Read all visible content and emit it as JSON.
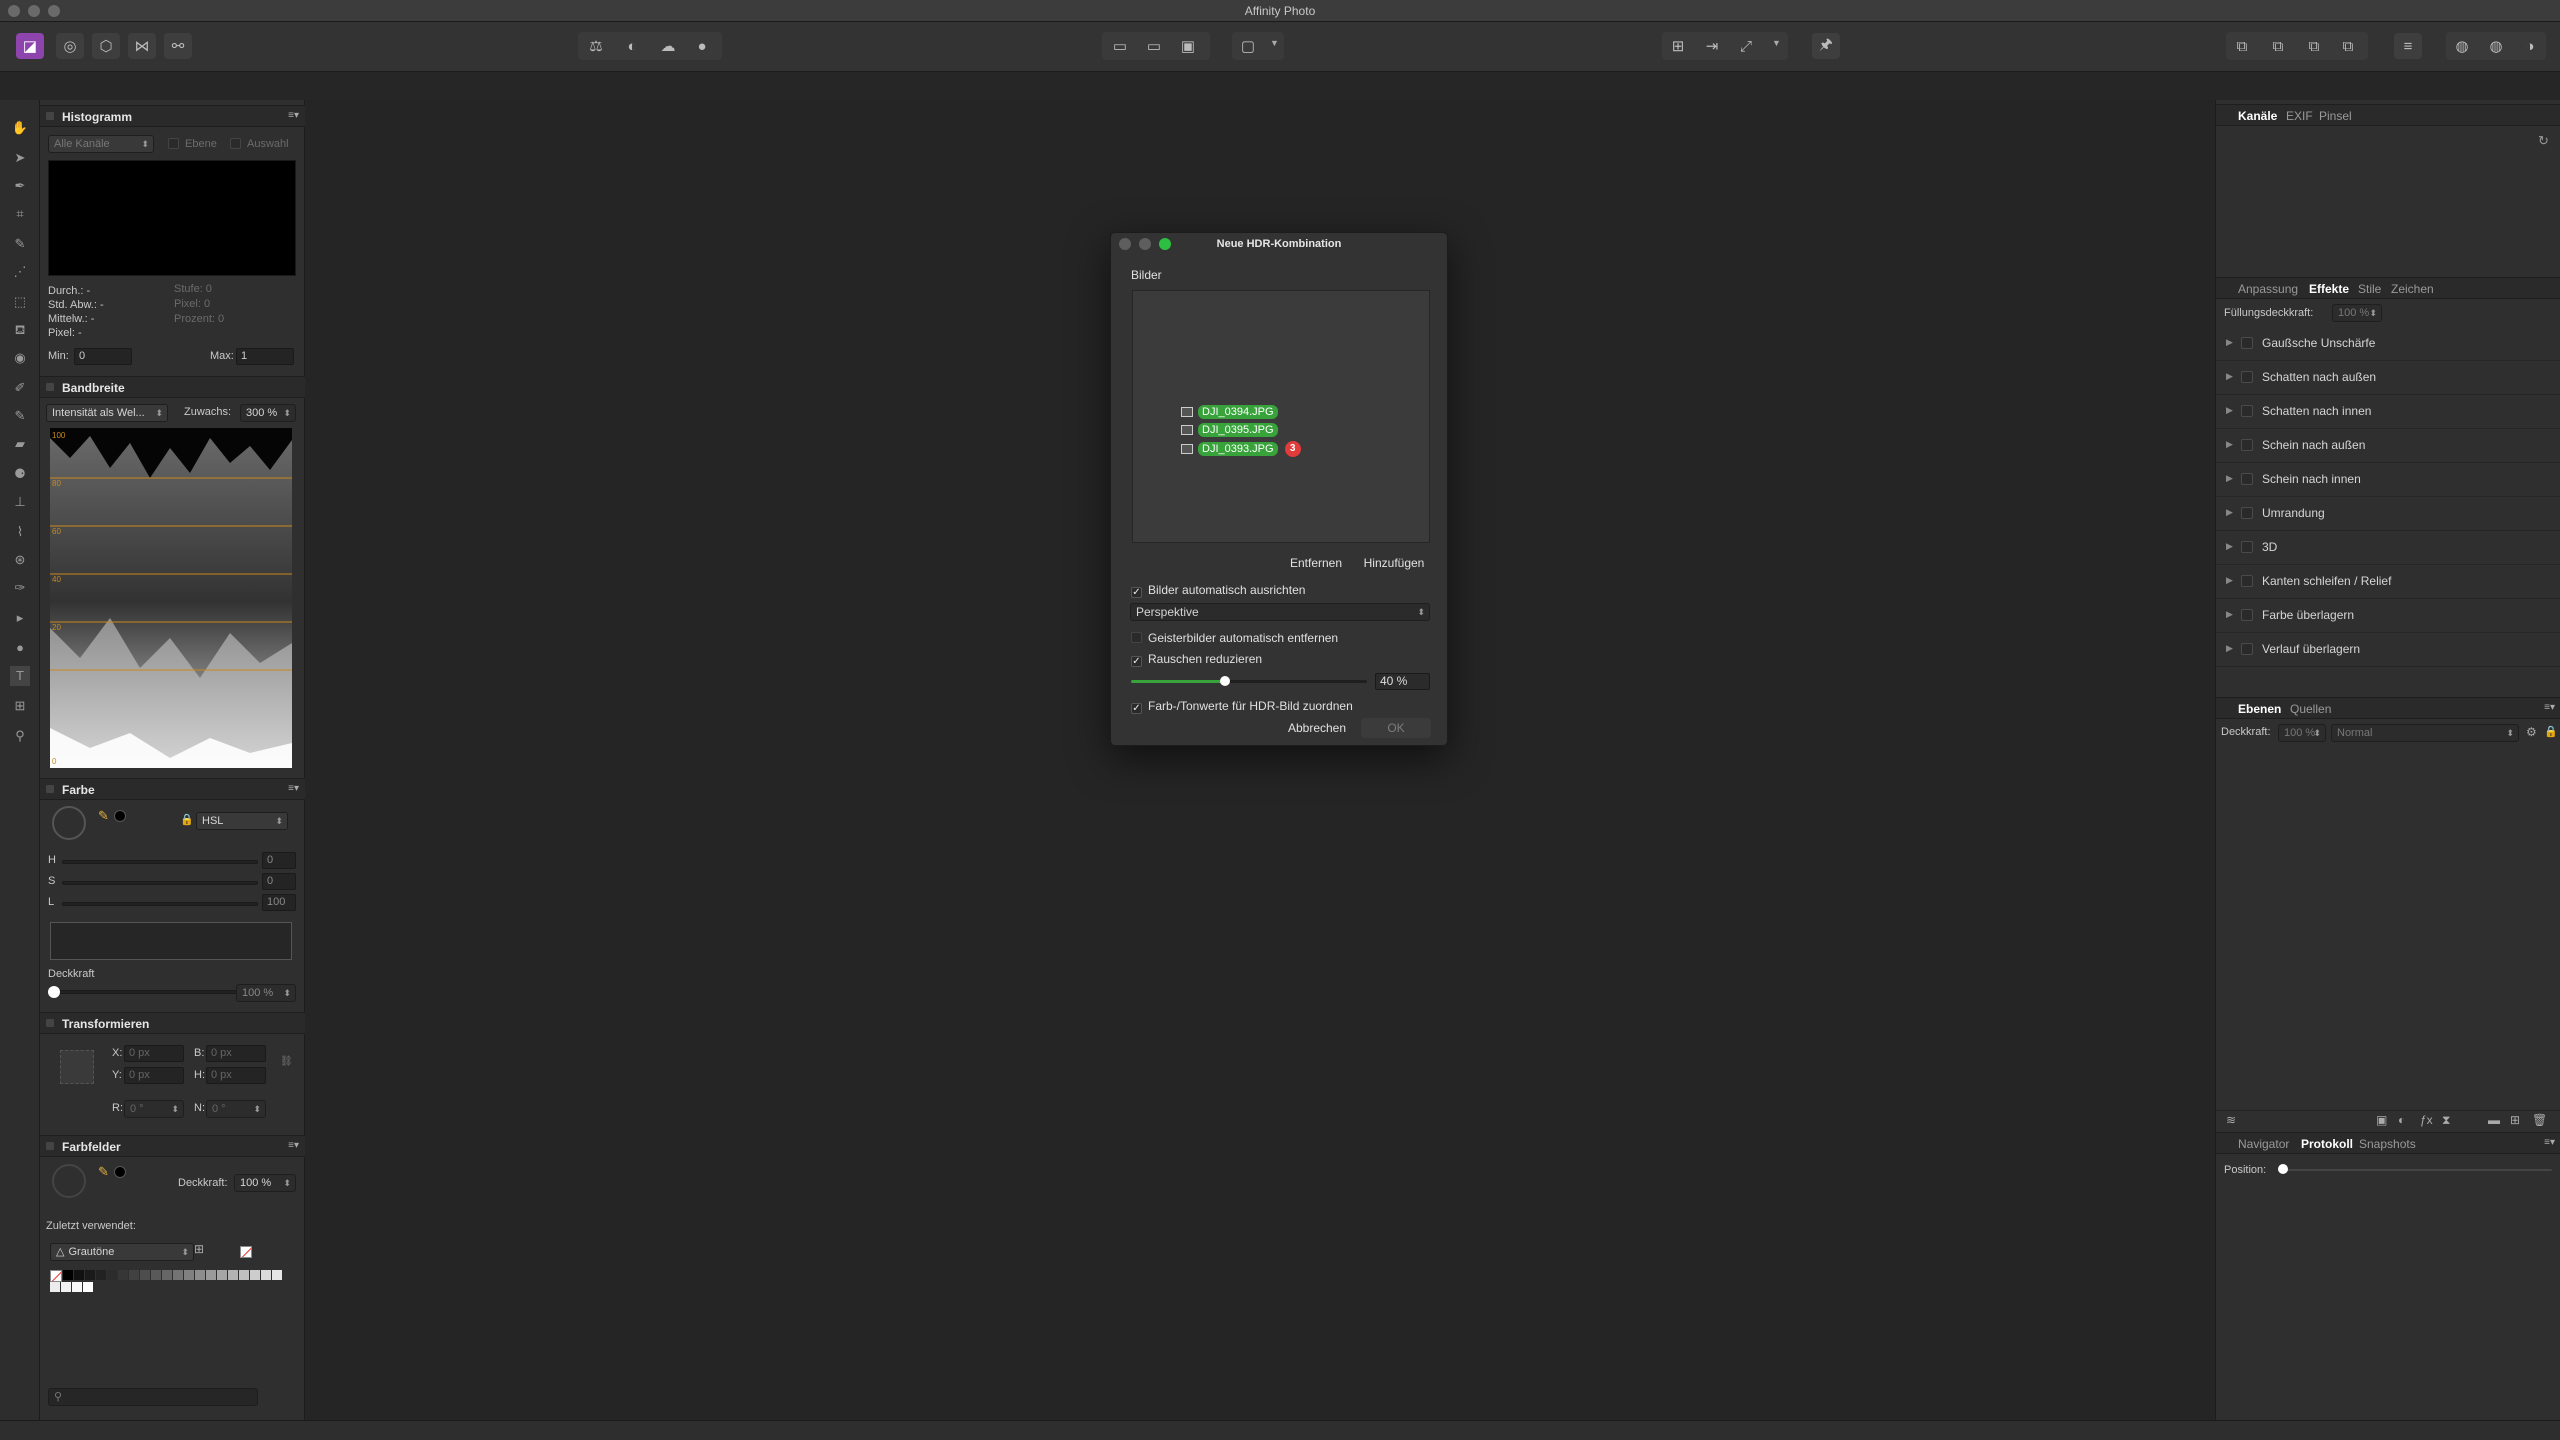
{
  "window": {
    "title": "Affinity Photo"
  },
  "colors": {
    "accent": "#37a33a",
    "badge": "#e23b3b",
    "persona": "#8e44ad"
  },
  "toolbar": {
    "persona_icons": [
      "photo-persona-icon",
      "liquify-persona-icon",
      "develop-persona-icon",
      "tone-mapping-persona-icon",
      "export-persona-icon"
    ],
    "tool_icons": [
      "auto-levels-icon",
      "auto-contrast-icon",
      "auto-colors-icon",
      "auto-white-balance-icon"
    ]
  },
  "histogram": {
    "title": "Histogramm",
    "channels": "Alle Kanäle",
    "layer_label": "Ebene",
    "selection_label": "Auswahl",
    "stats_left": [
      "Durch.: -",
      "Std. Abw.: -",
      "Mittelw.: -",
      "Pixel: -"
    ],
    "stats_right": [
      "Stufe: 0",
      "Pixel: 0",
      "Prozent: 0"
    ],
    "min_label": "Min:",
    "min_value": "0",
    "max_label": "Max:",
    "max_value": "1"
  },
  "scope": {
    "title": "Bandbreite",
    "mode": "Intensität als Wel...",
    "gain_label": "Zuwachs:",
    "gain_value": "300 %",
    "scale": [
      "100",
      "80",
      "60",
      "40",
      "20",
      "0"
    ]
  },
  "color": {
    "title": "Farbe",
    "model": "HSL",
    "h_label": "H",
    "h_value": "0",
    "s_label": "S",
    "s_value": "0",
    "l_label": "L",
    "l_value": "100",
    "opacity_label": "Deckkraft",
    "opacity_value": "100 %"
  },
  "transform": {
    "title": "Transformieren",
    "x_label": "X:",
    "x_value": "0 px",
    "y_label": "Y:",
    "y_value": "0 px",
    "w_label": "B:",
    "w_value": "0 px",
    "h_label": "H:",
    "h_value": "0 px",
    "r_label": "R:",
    "r_value": "0 °",
    "s_label": "N:",
    "s_value": "0 °"
  },
  "swatches": {
    "title": "Farbfelder",
    "opacity_label": "Deckkraft:",
    "opacity_value": "100 %",
    "recent_label": "Zuletzt verwendet:",
    "palette": "Grautöne"
  },
  "right": {
    "top_tabs": [
      "Kanäle",
      "EXIF",
      "Pinsel"
    ],
    "fx_tabs": [
      "Anpassung",
      "Effekte",
      "Stile",
      "Zeichen"
    ],
    "fill_label": "Füllungsdeckkraft:",
    "fill_value": "100 %",
    "effects": [
      "Gaußsche Unschärfe",
      "Schatten nach außen",
      "Schatten nach innen",
      "Schein nach außen",
      "Schein nach innen",
      "Umrandung",
      "3D",
      "Kanten schleifen / Relief",
      "Farbe überlagern",
      "Verlauf überlagern"
    ],
    "layer_tabs": [
      "Ebenen",
      "Quellen"
    ],
    "layer_opacity_label": "Deckkraft:",
    "layer_opacity_value": "100 %",
    "blend_mode": "Normal",
    "history_tabs": [
      "Navigator",
      "Protokoll",
      "Snapshots"
    ],
    "position_label": "Position:"
  },
  "dialog": {
    "title": "Neue HDR-Kombination",
    "images_label": "Bilder",
    "images": [
      "DJI_0394.JPG",
      "DJI_0395.JPG",
      "DJI_0393.JPG"
    ],
    "count_badge": "3",
    "remove_label": "Entfernen",
    "add_label": "Hinzufügen",
    "auto_align_label": "Bilder automatisch ausrichten",
    "auto_align_checked": true,
    "align_mode": "Perspektive",
    "deghost_label": "Geisterbilder automatisch entfernen",
    "deghost_checked": false,
    "noise_label": "Rauschen reduzieren",
    "noise_checked": true,
    "noise_value": "40 %",
    "noise_fraction": 0.4,
    "tonemap_label": "Farb-/Tonwerte für HDR-Bild zuordnen",
    "tonemap_checked": true,
    "cancel_label": "Abbrechen",
    "ok_label": "OK"
  }
}
